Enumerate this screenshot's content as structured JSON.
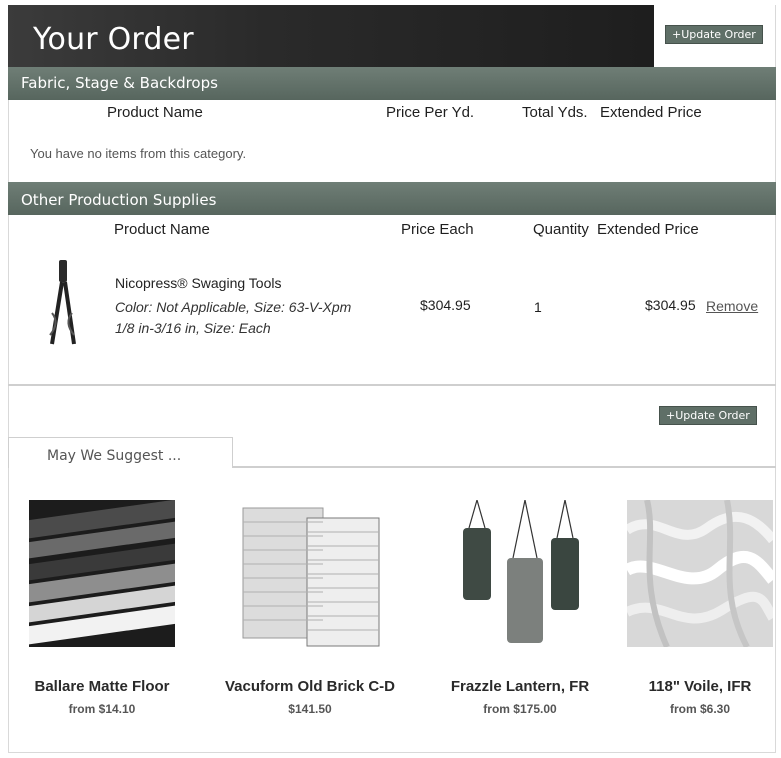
{
  "header": {
    "title": "Your Order",
    "update_label": "+Update Order"
  },
  "fabric": {
    "section_title": "Fabric, Stage & Backdrops",
    "columns": [
      "Product Name",
      "Price Per Yd.",
      "Total Yds.",
      "Extended Price"
    ],
    "empty_message": "You have no items from this category."
  },
  "supplies": {
    "section_title": "Other Production Supplies",
    "columns": [
      "Product Name",
      "Price Each",
      "Quantity",
      "Extended Price"
    ],
    "items": [
      {
        "name": "Nicopress® Swaging Tools",
        "details": "Color: Not Applicable, Size: 63-V-Xpm 1/8 in-3/16 in, Size: Each",
        "price": "$304.95",
        "quantity": "1",
        "extended": "$304.95",
        "remove_label": "Remove"
      }
    ]
  },
  "update_bottom_label": "+Update Order",
  "suggest": {
    "tab_label": "May We Suggest ...",
    "items": [
      {
        "name": "Ballare Matte Floor",
        "price": "from $14.10"
      },
      {
        "name": "Vacuform Old Brick C-D",
        "price": "$141.50"
      },
      {
        "name": "Frazzle Lantern, FR",
        "price": "from $175.00"
      },
      {
        "name": "118\" Voile, IFR",
        "price": "from $6.30"
      }
    ]
  }
}
